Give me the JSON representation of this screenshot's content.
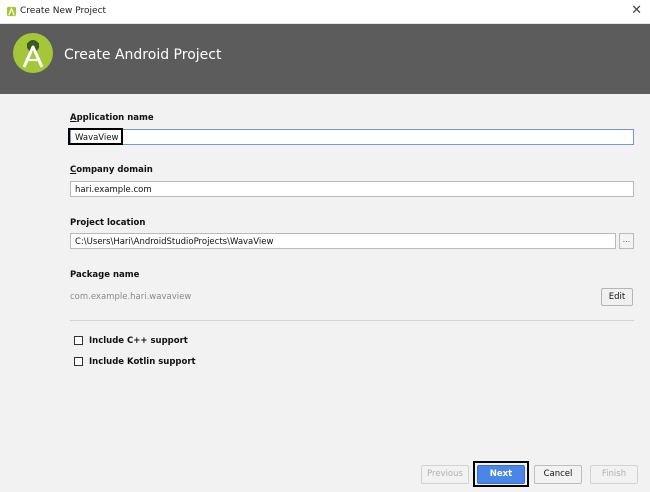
{
  "window": {
    "title": "Create New Project",
    "close_glyph": "✕",
    "app_icon": "android-studio-icon"
  },
  "header": {
    "title": "Create Android Project",
    "logo_icon": "android-studio-logo-icon"
  },
  "form": {
    "app_name": {
      "label_prefix": "A",
      "label_rest": "pplication name",
      "value": "WavaView"
    },
    "company_domain": {
      "label_prefix": "C",
      "label_rest": "ompany domain",
      "value": "hari.example.com"
    },
    "project_location": {
      "label": "Project location",
      "value": "C:\\Users\\Hari\\AndroidStudioProjects\\WavaView",
      "browse_label": "..."
    },
    "package_name": {
      "label": "Package name",
      "value": "com.example.hari.wavaview",
      "edit_label": "Edit"
    },
    "checkboxes": [
      {
        "label": "Include C++ support",
        "checked": false
      },
      {
        "label": "Include Kotlin support",
        "checked": false
      }
    ]
  },
  "footer": {
    "previous_label": "Previous",
    "next_label": "Next",
    "cancel_label": "Cancel",
    "finish_label": "Finish"
  },
  "colors": {
    "header_bg": "#5c5c5c",
    "primary_button": "#4a86e8",
    "focus_border": "#6f9ad4",
    "logo_green": "#a4c639"
  }
}
